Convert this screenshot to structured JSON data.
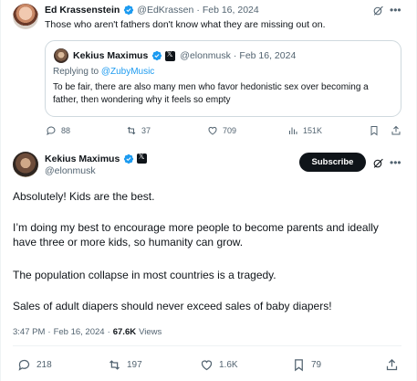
{
  "colors": {
    "accent": "#1d9bf0",
    "text": "#0f1419",
    "muted": "#536471",
    "border": "#cfd9de",
    "verified": "#1d9bf0"
  },
  "parent_tweet": {
    "author_name": "Ed Krassenstein",
    "handle": "@EdKrassen",
    "separator": "·",
    "date": "Feb 16, 2024",
    "text": "Those who aren't fathers don't know what they are missing out on.",
    "quoted": {
      "author_name": "Kekius Maximus",
      "handle": "@elonmusk",
      "separator": "·",
      "date": "Feb 16, 2024",
      "replying_prefix": "Replying to",
      "replying_to": "@ZubyMusic",
      "text": "To be fair, there are also many men who favor hedonistic sex over becoming a father, then wondering why it feels so empty"
    },
    "stats": {
      "replies": "88",
      "reposts": "37",
      "likes": "709",
      "views": "151K"
    }
  },
  "main_tweet": {
    "author_name": "Kekius Maximus",
    "handle": "@elonmusk",
    "subscribe_label": "Subscribe",
    "paragraphs": [
      "Absolutely! Kids are the best.",
      "I’m doing my best to encourage more people to become parents and ideally have three or more kids, so humanity can grow.",
      "The population collapse in most countries is a tragedy.",
      "Sales of adult diapers should never exceed sales of baby diapers!"
    ],
    "time": "3:47 PM",
    "separator": "·",
    "date": "Feb 16, 2024",
    "views_count": "67.6K",
    "views_label": "Views",
    "stats": {
      "replies": "218",
      "reposts": "197",
      "likes": "1.6K",
      "bookmarks": "79"
    }
  },
  "icons": [
    "grok-icon",
    "more-icon",
    "verified-icon",
    "x-affiliate-icon",
    "reply-icon",
    "repost-icon",
    "like-icon",
    "views-icon",
    "bookmark-icon",
    "share-icon"
  ]
}
